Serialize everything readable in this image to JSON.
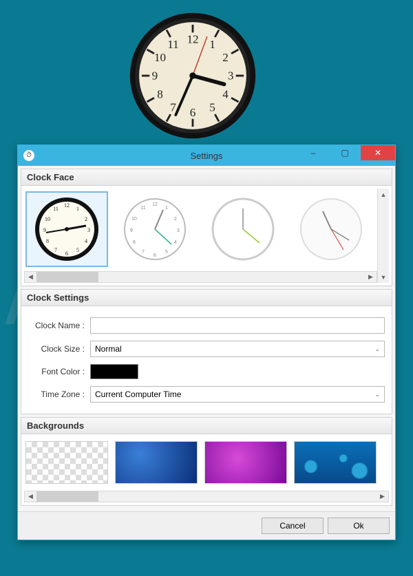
{
  "dialog": {
    "title": "Settings",
    "sections": {
      "clock_face": "Clock Face",
      "clock_settings": "Clock Settings",
      "backgrounds": "Backgrounds"
    },
    "fields": {
      "clock_name_label": "Clock Name :",
      "clock_name_value": "",
      "clock_size_label": "Clock Size :",
      "clock_size_value": "Normal",
      "font_color_label": "Font Color :",
      "font_color_value": "#000000",
      "time_zone_label": "Time Zone :",
      "time_zone_value": "Current Computer Time"
    },
    "buttons": {
      "cancel": "Cancel",
      "ok": "Ok"
    }
  },
  "icons": {
    "minimize": "–",
    "maximize": "▢",
    "close": "✕",
    "chevron_down": "⌄",
    "arrow_left": "◀",
    "arrow_right": "▶",
    "arrow_up": "▲",
    "arrow_down": "▼"
  },
  "clock_face_options": [
    "classic-black",
    "thin-green",
    "minimal-lime",
    "simple-red"
  ],
  "background_options": [
    "transparent",
    "blue-gradient",
    "magenta-gradient",
    "blue-bubbles"
  ],
  "watermark": "PCrisk.com",
  "desktop_clock": {
    "time_shown": "3:36:07",
    "face": "classic-black"
  }
}
